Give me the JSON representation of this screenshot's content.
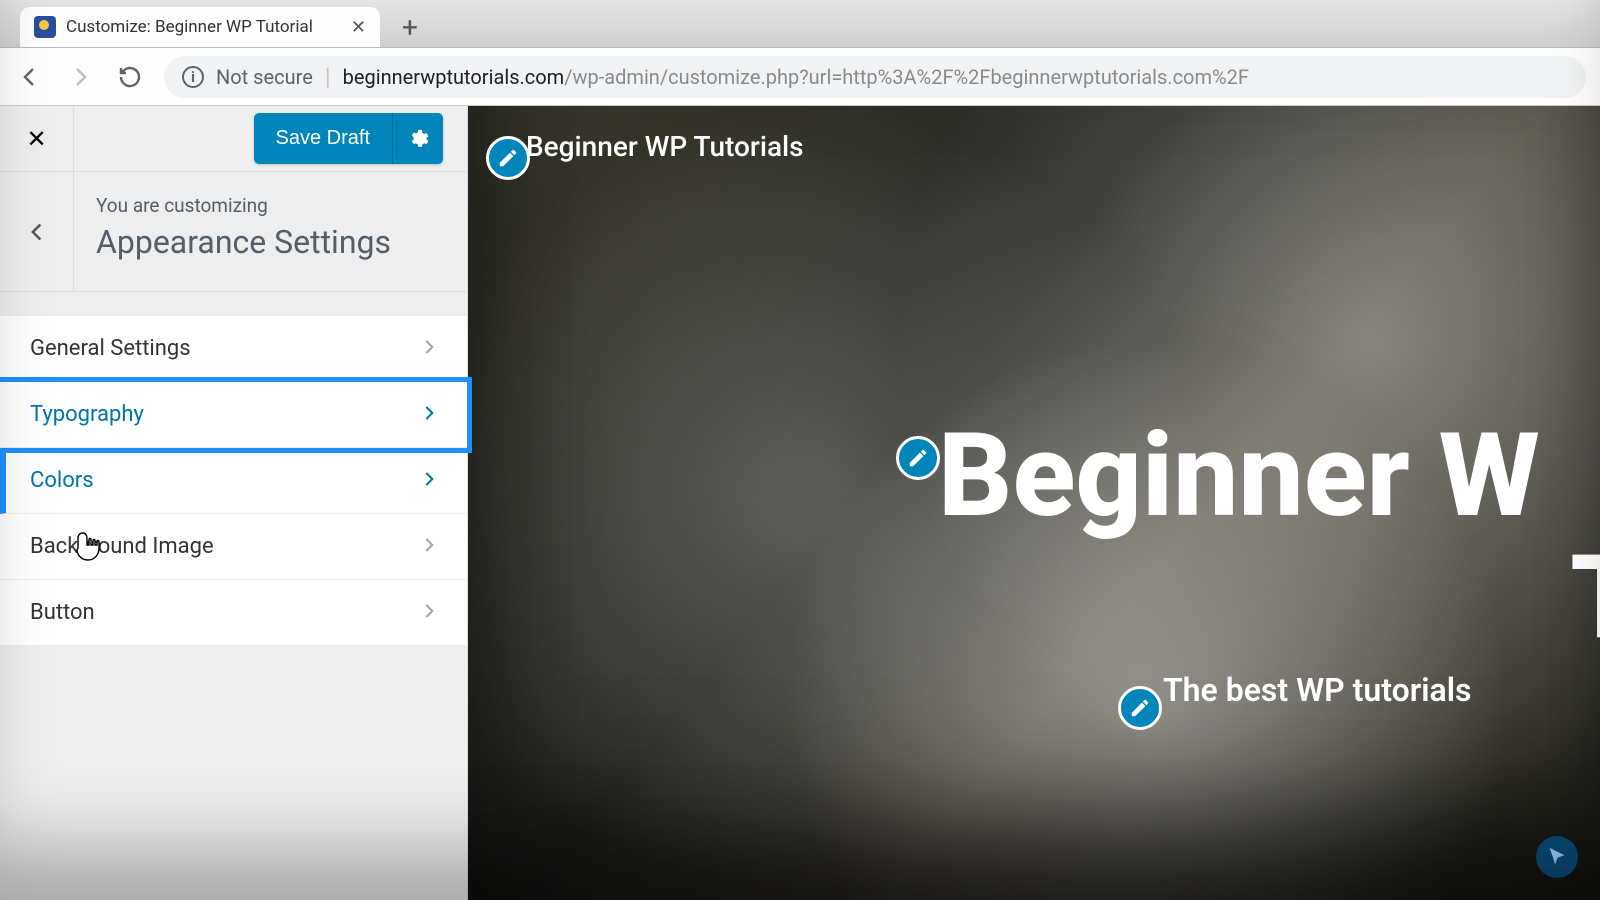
{
  "browser": {
    "tab_title": "Customize: Beginner WP Tutorial",
    "not_secure_label": "Not secure",
    "url_host": "beginnerwptutorials.com",
    "url_path": "/wp-admin/customize.php?url=http%3A%2F%2Fbeginnerwptutorials.com%2F"
  },
  "sidebar": {
    "save_button_label": "Save Draft",
    "crumb_label": "You are customizing",
    "section_title": "Appearance Settings",
    "items": [
      {
        "label": "General Settings",
        "state": "normal"
      },
      {
        "label": "Typography",
        "state": "highlighted"
      },
      {
        "label": "Colors",
        "state": "highlighted-left"
      },
      {
        "label": "Background Image",
        "state": "normal"
      },
      {
        "label": "Button",
        "state": "normal"
      }
    ]
  },
  "preview": {
    "site_title_small": "Beginner WP Tutorials",
    "hero_title_line1": "Beginner W",
    "hero_title_line2": "Tutor",
    "tagline": "The best WP tutorials"
  },
  "colors": {
    "wp_primary": "#0085ba",
    "highlight": "#1e90ff"
  }
}
